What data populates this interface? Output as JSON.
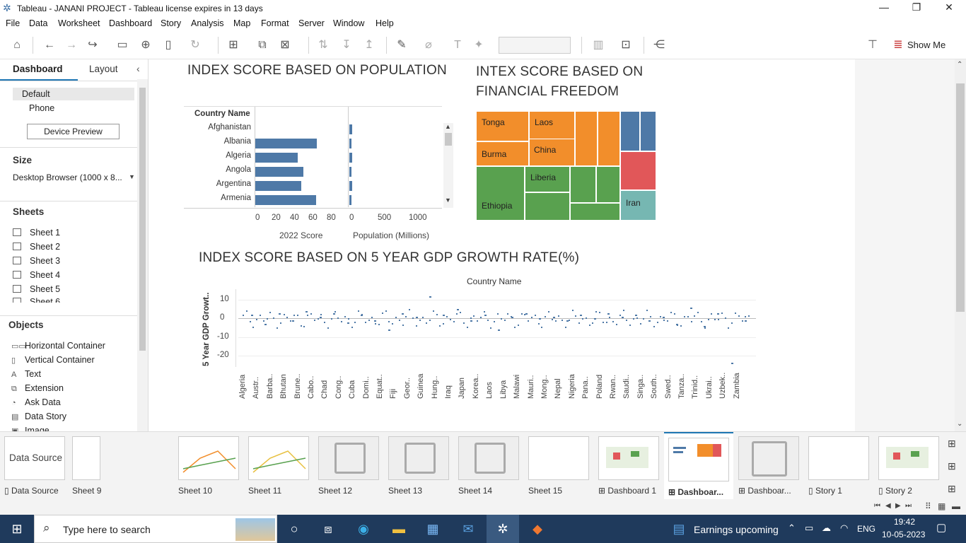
{
  "window": {
    "title": "Tableau - JANANI PROJECT - Tableau license expires in 13 days"
  },
  "menu": [
    "File",
    "Data",
    "Worksheet",
    "Dashboard",
    "Story",
    "Analysis",
    "Map",
    "Format",
    "Server",
    "Window",
    "Help"
  ],
  "toolbar": {
    "show_me": "Show Me"
  },
  "left": {
    "tab_dashboard": "Dashboard",
    "tab_layout": "Layout",
    "device_default": "Default",
    "device_phone": "Phone",
    "device_preview": "Device Preview",
    "size_head": "Size",
    "size_value": "Desktop Browser (1000 x 8...",
    "sheets_head": "Sheets",
    "sheets": [
      "Sheet 1",
      "Sheet 2",
      "Sheet 3",
      "Sheet 4",
      "Sheet 5",
      "Sheet 6"
    ],
    "objects_head": "Objects",
    "objects": [
      {
        "icon": "hcontainer-icon",
        "glyph": "▭▭",
        "label": "Horizontal Container"
      },
      {
        "icon": "vcontainer-icon",
        "glyph": "▯",
        "label": "Vertical Container"
      },
      {
        "icon": "text-icon",
        "glyph": "A",
        "label": "Text"
      },
      {
        "icon": "extension-icon",
        "glyph": "⧉",
        "label": "Extension"
      },
      {
        "icon": "ask-data-icon",
        "glyph": "◔",
        "label": "Ask Data"
      },
      {
        "icon": "data-story-icon",
        "glyph": "▤",
        "label": "Data Story"
      },
      {
        "icon": "image-icon",
        "glyph": "▣",
        "label": "Image"
      }
    ]
  },
  "dashboard": {
    "pop_title": "INDEX SCORE BASED ON POPULATION",
    "pop_header": "Country Name",
    "pop_x1_label": "2022 Score",
    "pop_x2_label": "Population (Millions)",
    "fin_title_1": "INTEX SCORE BASED ON",
    "fin_title_2": "FINANCIAL FREEDOM",
    "gdp_title": "INDEX SCORE BASED ON 5 YEAR GDP GROWTH RATE(%)",
    "gdp_header": "Country Name",
    "gdp_ylabel": "5 Year GDP Growt..",
    "treemap_labels": [
      "Tonga",
      "Laos",
      "Burma",
      "China",
      "Liberia",
      "Ethiopia",
      "Iran"
    ]
  },
  "chart_data": [
    {
      "type": "bar",
      "title": "INDEX SCORE BASED ON POPULATION",
      "xlabel": "2022 Score",
      "categories": [
        "Afghanistan",
        "Albania",
        "Algeria",
        "Angola",
        "Argentina",
        "Armenia"
      ],
      "values": [
        0,
        67,
        46,
        52,
        50,
        66
      ],
      "xlim": [
        0,
        100
      ],
      "ticks": [
        "0",
        "20",
        "40",
        "60",
        "80"
      ]
    },
    {
      "type": "bar",
      "xlabel": "Population (Millions)",
      "categories": [
        "Afghanistan",
        "Albania",
        "Algeria",
        "Angola",
        "Argentina",
        "Armenia"
      ],
      "values": [
        38,
        3,
        44,
        33,
        45,
        3
      ],
      "xlim": [
        0,
        1400
      ],
      "ticks": [
        "0",
        "500",
        "1000"
      ]
    },
    {
      "type": "scatter",
      "title": "INDEX SCORE BASED ON 5 YEAR GDP GROWTH RATE(%)",
      "xlabel": "Country Name",
      "ylabel": "5 Year GDP Growt..",
      "ylim": [
        -25,
        12
      ],
      "yticks": [
        "10",
        "0",
        "-10",
        "-20"
      ],
      "categories": [
        "Algeria",
        "Austr..",
        "Barba..",
        "Bhutan",
        "Brune..",
        "Cabo..",
        "Chad",
        "Cong..",
        "Cuba",
        "Domi..",
        "Equat..",
        "Fiji",
        "Geor..",
        "Guinea",
        "Hung..",
        "Iraq",
        "Japan",
        "Korea..",
        "Laos",
        "Libya",
        "Malawi",
        "Mauri..",
        "Mong..",
        "Nepal",
        "Nigeria",
        "Pana..",
        "Poland",
        "Rwan..",
        "Saudi..",
        "Singa..",
        "South..",
        "Swed..",
        "Tanza..",
        "Trinid..",
        "Ukrai..",
        "Uzbek..",
        "Zambia"
      ],
      "values": [
        2,
        -3,
        3,
        -1,
        4,
        1,
        3,
        -2,
        2,
        -1,
        -6,
        3,
        1,
        12,
        2,
        5,
        -1,
        2,
        -6,
        1,
        3,
        0,
        1,
        -1,
        2,
        0,
        3,
        1,
        2,
        -1,
        1,
        -3,
        6,
        -4,
        3,
        -24,
        -1
      ]
    }
  ],
  "tabs": [
    {
      "label": "Data Source",
      "icon": "datasource-icon"
    },
    {
      "label": "Sheet 9"
    },
    {
      "label": "Sheet 10"
    },
    {
      "label": "Sheet 11"
    },
    {
      "label": "Sheet 12"
    },
    {
      "label": "Sheet 13"
    },
    {
      "label": "Sheet 14"
    },
    {
      "label": "Sheet 15"
    },
    {
      "label": "Dashboard 1"
    },
    {
      "label": "Dashboar..."
    },
    {
      "label": "Dashboar..."
    },
    {
      "label": "Story 1"
    },
    {
      "label": "Story 2"
    }
  ],
  "taskbar": {
    "search_placeholder": "Type here to search",
    "news": "Earnings upcoming",
    "lang": "ENG",
    "time": "19:42",
    "date": "10-05-2023"
  },
  "colors": {
    "bar": "#4e79a7",
    "orange": "#f28e2b",
    "green": "#59a14f",
    "blue": "#4e79a7",
    "red": "#e15759",
    "teal": "#76b7b2"
  }
}
